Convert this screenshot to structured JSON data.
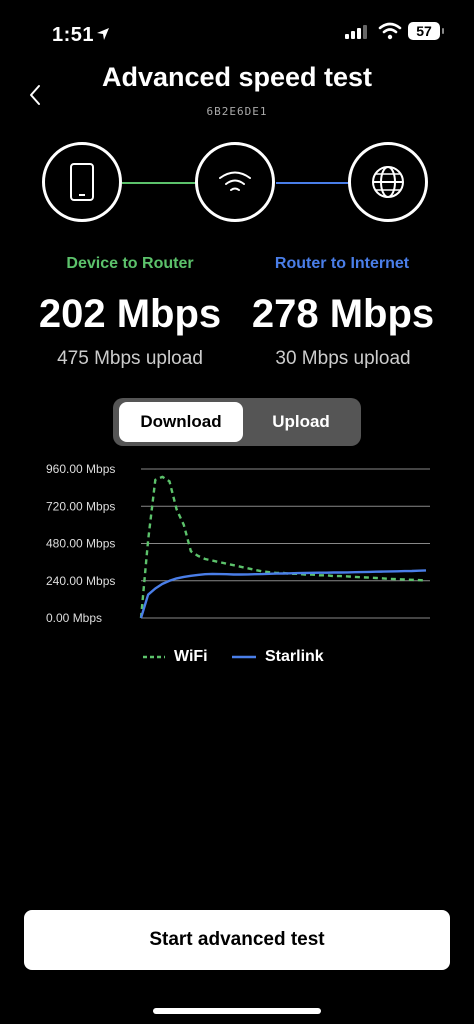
{
  "status": {
    "time": "1:51",
    "battery": "57"
  },
  "header": {
    "title": "Advanced speed test",
    "device_id": "6B2E6DE1"
  },
  "diagram": {
    "left": {
      "label": "Device to Router",
      "speed": "202 Mbps",
      "upload": "475 Mbps upload",
      "color": "#5cc26b"
    },
    "right": {
      "label": "Router to Internet",
      "speed": "278 Mbps",
      "upload": "30 Mbps upload",
      "color": "#4a7ee8"
    }
  },
  "toggle": {
    "download": "Download",
    "upload": "Upload",
    "selected": "Download"
  },
  "chart_data": {
    "type": "line",
    "y_ticks": [
      "960.00 Mbps",
      "720.00 Mbps",
      "480.00 Mbps",
      "240.00 Mbps",
      "0.00 Mbps"
    ],
    "ylim": [
      0,
      960
    ],
    "x": [
      0,
      1,
      2,
      3,
      4,
      5,
      6,
      7,
      8,
      9,
      10,
      11,
      12,
      13,
      14,
      15,
      16,
      17,
      18,
      19,
      20,
      21,
      22,
      23,
      24,
      25,
      26,
      27,
      28,
      29,
      30,
      31,
      32,
      33,
      34,
      35,
      36,
      37,
      38,
      39,
      40
    ],
    "series": [
      {
        "name": "WiFi",
        "color": "#5cc26b",
        "dash": true,
        "values": [
          0,
          500,
          890,
          910,
          880,
          700,
          600,
          430,
          400,
          380,
          370,
          360,
          350,
          340,
          330,
          320,
          310,
          300,
          295,
          290,
          290,
          285,
          285,
          280,
          280,
          275,
          275,
          270,
          270,
          268,
          265,
          262,
          260,
          258,
          255,
          252,
          250,
          248,
          246,
          244,
          242
        ]
      },
      {
        "name": "Starlink",
        "color": "#4a7ee8",
        "dash": false,
        "values": [
          0,
          150,
          190,
          220,
          240,
          255,
          265,
          272,
          278,
          282,
          284,
          283,
          282,
          280,
          280,
          281,
          282,
          283,
          285,
          286,
          287,
          288,
          289,
          290,
          291,
          292,
          292,
          293,
          293,
          294,
          295,
          296,
          297,
          298,
          299,
          300,
          301,
          302,
          303,
          305,
          307
        ]
      }
    ]
  },
  "actions": {
    "start": "Start advanced test"
  }
}
